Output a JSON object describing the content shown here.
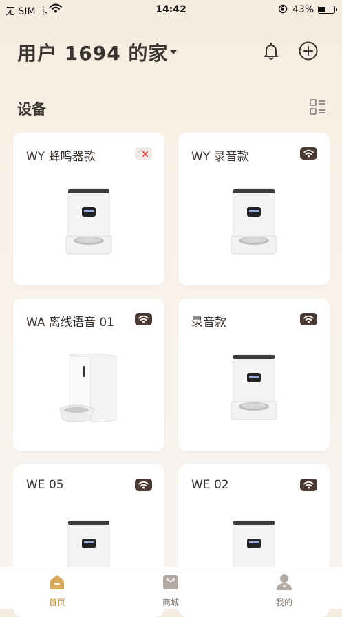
{
  "status_bar": {
    "carrier": "无 SIM 卡",
    "time": "14:42",
    "battery": "43%"
  },
  "header": {
    "home_name": "用户 1694 的家"
  },
  "section": {
    "title": "设备"
  },
  "devices": [
    {
      "name": "WY 蜂鸣器款",
      "status": "offline",
      "image": "feeder-front"
    },
    {
      "name": "WY 录音款",
      "status": "wifi",
      "image": "feeder-front"
    },
    {
      "name": "WA 离线语音 01",
      "status": "wifi",
      "image": "feeder-side"
    },
    {
      "name": "录音款",
      "status": "wifi",
      "image": "feeder-front"
    },
    {
      "name": "WE 05",
      "status": "wifi",
      "image": "feeder-front"
    },
    {
      "name": "WE 02",
      "status": "wifi",
      "image": "feeder-front"
    }
  ],
  "tab_bar": {
    "tabs": [
      {
        "label": "首页",
        "icon": "home-icon",
        "active": true
      },
      {
        "label": "商城",
        "icon": "shop-bag-icon",
        "active": false
      },
      {
        "label": "我的",
        "icon": "profile-icon",
        "active": false
      }
    ]
  },
  "colors": {
    "accent": "#c8913b",
    "text": "#3a3430",
    "wifi_badge": "#4a3a33"
  }
}
